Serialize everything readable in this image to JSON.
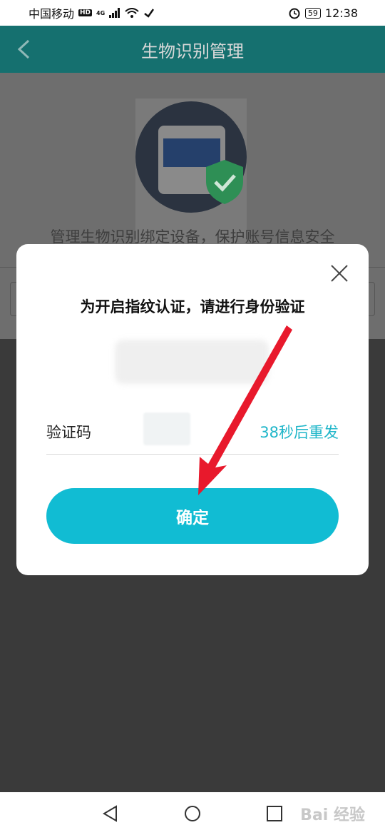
{
  "status_bar": {
    "carrier": "中国移动",
    "hd": "HD",
    "network": "4G",
    "battery": "59",
    "time": "12:38"
  },
  "app_bar": {
    "title": "生物识别管理",
    "back_icon": "chevron-left-icon"
  },
  "page": {
    "caption": "管理生物识别绑定设备，保护账号信息安全"
  },
  "dialog": {
    "title": "为开启指纹认证，请进行身份验证",
    "code_label": "验证码",
    "resend_text": "38秒后重发",
    "confirm_label": "确定",
    "close_icon": "close-icon"
  },
  "nav_bar": {
    "icons": [
      "back-triangle-icon",
      "home-circle-icon",
      "recent-square-icon"
    ]
  },
  "watermark": "Bai 经验",
  "colors": {
    "accent": "#11bcd3",
    "app_bar": "#15706f",
    "overlay": "#3a3a3a",
    "arrow": "#e8192c"
  }
}
